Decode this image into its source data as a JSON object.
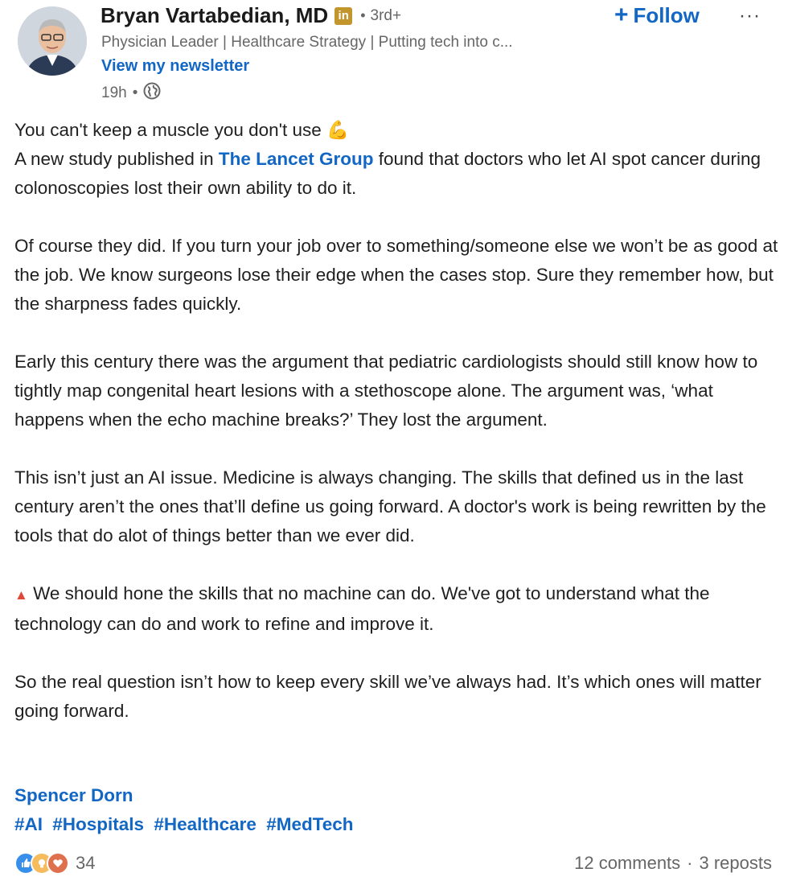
{
  "author": {
    "name": "Bryan Vartabedian, MD",
    "badge": "in",
    "degree": "3rd+",
    "headline": "Physician Leader | Healthcare Strategy | Putting tech into c...",
    "newsletter_link": "View my newsletter",
    "time": "19h",
    "visibility_icon": "globe-icon"
  },
  "actions": {
    "follow_plus": "+",
    "follow_label": "Follow",
    "more": "···"
  },
  "post": {
    "line1": "You can't keep a muscle you don't use",
    "emoji1": "💪",
    "p1_pre": "A new study published in ",
    "p1_link": "The Lancet Group",
    "p1_post": " found that doctors who let AI spot cancer during colonoscopies lost their own ability to do it.",
    "p2": "Of course they did. If you turn your job over to something/someone else we won’t be as good at the job. We know surgeons lose their edge when the cases stop. Sure they remember how, but the sharpness fades quickly.",
    "p3": "Early this century there was the argument that pediatric cardiologists should still know how to tightly map congenital heart lesions with a stethoscope alone. The argument was, ‘what happens when the echo machine breaks?’ They lost the argument.",
    "p4": "This isn’t just an AI issue. Medicine is always changing. The skills that defined us in the last century aren’t the ones that’ll define us going forward. A doctor's work is being rewritten by the tools that do alot of things better than we ever did.",
    "p5_icon": "▲",
    "p5": " We should hone the skills that no machine can do. We've got to understand what the technology can do and work to refine and improve it.",
    "p6": "So the real question isn’t how to keep every skill we’ve always had. It’s which ones will matter going forward."
  },
  "mention": "Spencer Dorn",
  "hashtags": [
    "#AI",
    "#Hospitals",
    "#Healthcare",
    "#MedTech"
  ],
  "footer": {
    "reaction_count": "34",
    "comments": "12 comments",
    "separator": "·",
    "reposts": "3 reposts"
  },
  "colors": {
    "link": "#1266c4",
    "badge": "#c3962d",
    "muted": "#666666",
    "text": "#1f1f1f"
  }
}
